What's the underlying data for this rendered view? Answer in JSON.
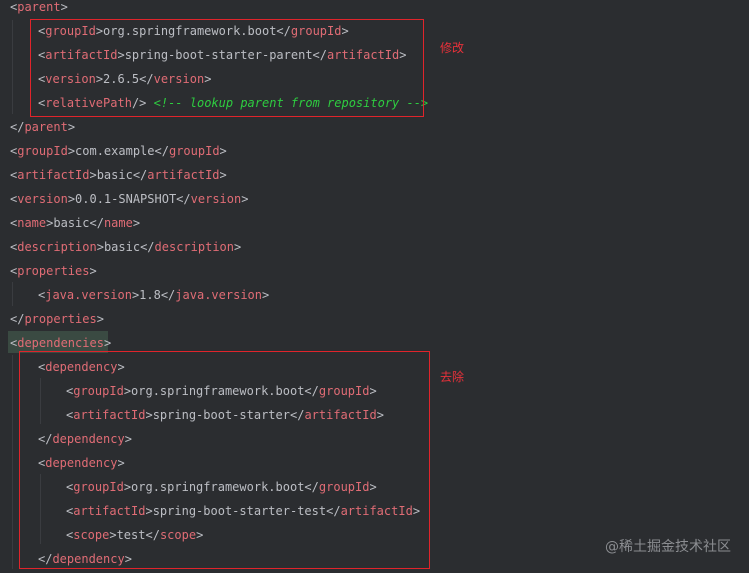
{
  "lines": [
    {
      "parts": [
        [
          "b",
          "<"
        ],
        [
          "t",
          "parent"
        ],
        [
          "b",
          ">"
        ]
      ]
    },
    {
      "parts": [
        [
          "b",
          "<"
        ],
        [
          "t",
          "groupId"
        ],
        [
          "b",
          ">org.springframework.boot</"
        ],
        [
          "t",
          "groupId"
        ],
        [
          "b",
          ">"
        ]
      ]
    },
    {
      "parts": [
        [
          "b",
          "<"
        ],
        [
          "t",
          "artifactId"
        ],
        [
          "b",
          ">spring-boot-starter-parent</"
        ],
        [
          "t",
          "artifactId"
        ],
        [
          "b",
          ">"
        ]
      ]
    },
    {
      "parts": [
        [
          "b",
          "<"
        ],
        [
          "t",
          "version"
        ],
        [
          "b",
          ">2.6.5</"
        ],
        [
          "t",
          "version"
        ],
        [
          "b",
          ">"
        ]
      ]
    },
    {
      "parts": [
        [
          "b",
          "<"
        ],
        [
          "t",
          "relativePath"
        ],
        [
          "b",
          "/> "
        ],
        [
          "c",
          "<!-- lookup parent from repository -->"
        ]
      ]
    },
    {
      "parts": [
        [
          "b",
          "</"
        ],
        [
          "t",
          "parent"
        ],
        [
          "b",
          ">"
        ]
      ]
    },
    {
      "parts": [
        [
          "b",
          "<"
        ],
        [
          "t",
          "groupId"
        ],
        [
          "b",
          ">com.example</"
        ],
        [
          "t",
          "groupId"
        ],
        [
          "b",
          ">"
        ]
      ]
    },
    {
      "parts": [
        [
          "b",
          "<"
        ],
        [
          "t",
          "artifactId"
        ],
        [
          "b",
          ">basic</"
        ],
        [
          "t",
          "artifactId"
        ],
        [
          "b",
          ">"
        ]
      ]
    },
    {
      "parts": [
        [
          "b",
          "<"
        ],
        [
          "t",
          "version"
        ],
        [
          "b",
          ">0.0.1-SNAPSHOT</"
        ],
        [
          "t",
          "version"
        ],
        [
          "b",
          ">"
        ]
      ]
    },
    {
      "parts": [
        [
          "b",
          "<"
        ],
        [
          "t",
          "name"
        ],
        [
          "b",
          ">basic</"
        ],
        [
          "t",
          "name"
        ],
        [
          "b",
          ">"
        ]
      ]
    },
    {
      "parts": [
        [
          "b",
          "<"
        ],
        [
          "t",
          "description"
        ],
        [
          "b",
          ">basic</"
        ],
        [
          "t",
          "description"
        ],
        [
          "b",
          ">"
        ]
      ]
    },
    {
      "parts": [
        [
          "b",
          "<"
        ],
        [
          "t",
          "properties"
        ],
        [
          "b",
          ">"
        ]
      ]
    },
    {
      "parts": [
        [
          "b",
          "<"
        ],
        [
          "t",
          "java.version"
        ],
        [
          "b",
          ">1.8</"
        ],
        [
          "t",
          "java.version"
        ],
        [
          "b",
          ">"
        ]
      ]
    },
    {
      "parts": [
        [
          "b",
          "</"
        ],
        [
          "t",
          "properties"
        ],
        [
          "b",
          ">"
        ]
      ]
    },
    {
      "parts": [
        [
          "b",
          "<"
        ],
        [
          "t",
          "dependencies"
        ],
        [
          "b",
          ">"
        ]
      ]
    },
    {
      "parts": [
        [
          "b",
          "<"
        ],
        [
          "t",
          "dependency"
        ],
        [
          "b",
          ">"
        ]
      ]
    },
    {
      "parts": [
        [
          "b",
          "<"
        ],
        [
          "t",
          "groupId"
        ],
        [
          "b",
          ">org.springframework.boot</"
        ],
        [
          "t",
          "groupId"
        ],
        [
          "b",
          ">"
        ]
      ]
    },
    {
      "parts": [
        [
          "b",
          "<"
        ],
        [
          "t",
          "artifactId"
        ],
        [
          "b",
          ">spring-boot-starter</"
        ],
        [
          "t",
          "artifactId"
        ],
        [
          "b",
          ">"
        ]
      ]
    },
    {
      "parts": [
        [
          "b",
          "</"
        ],
        [
          "t",
          "dependency"
        ],
        [
          "b",
          ">"
        ]
      ]
    },
    {
      "parts": [
        [
          "b",
          "<"
        ],
        [
          "t",
          "dependency"
        ],
        [
          "b",
          ">"
        ]
      ]
    },
    {
      "parts": [
        [
          "b",
          "<"
        ],
        [
          "t",
          "groupId"
        ],
        [
          "b",
          ">org.springframework.boot</"
        ],
        [
          "t",
          "groupId"
        ],
        [
          "b",
          ">"
        ]
      ]
    },
    {
      "parts": [
        [
          "b",
          "<"
        ],
        [
          "t",
          "artifactId"
        ],
        [
          "b",
          ">spring-boot-starter-test</"
        ],
        [
          "t",
          "artifactId"
        ],
        [
          "b",
          ">"
        ]
      ]
    },
    {
      "parts": [
        [
          "b",
          "<"
        ],
        [
          "t",
          "scope"
        ],
        [
          "b",
          ">test</"
        ],
        [
          "t",
          "scope"
        ],
        [
          "b",
          ">"
        ]
      ]
    },
    {
      "parts": [
        [
          "b",
          "</"
        ],
        [
          "t",
          "dependency"
        ],
        [
          "b",
          ">"
        ]
      ]
    }
  ],
  "annotations": {
    "modify": "修改",
    "remove": "去除"
  },
  "watermark": "@稀土掘金技术社区",
  "colors": {
    "background": "#2b2d30",
    "tag": "#e06c75",
    "text": "#bcbec4",
    "comment": "#2ecc40",
    "annotation_box": "#e0242b"
  }
}
